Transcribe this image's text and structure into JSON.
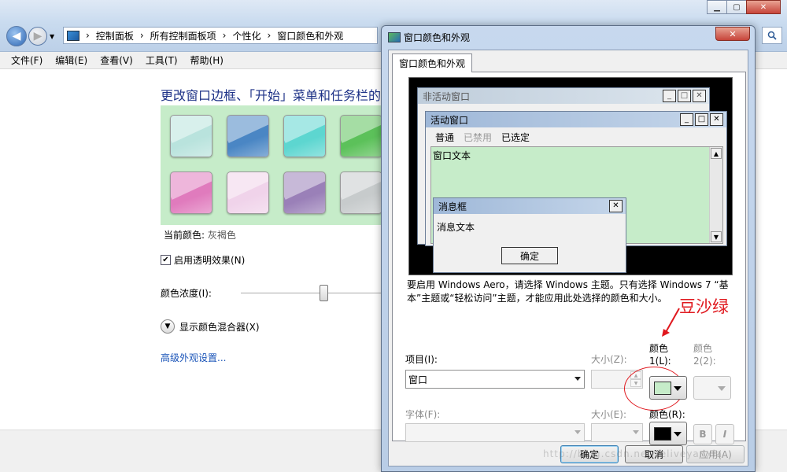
{
  "background_window": {
    "breadcrumbs": [
      "控制面板",
      "所有控制面板项",
      "个性化",
      "窗口颜色和外观"
    ],
    "menu": [
      "文件(F)",
      "编辑(E)",
      "查看(V)",
      "工具(T)",
      "帮助(H)"
    ],
    "heading": "更改窗口边框、「开始」菜单和任务栏的",
    "swatch_colors": [
      "#b9e3dd",
      "#4a86c4",
      "#5dd6d0",
      "#5cc15a",
      "#e07bbd",
      "#f0d3ea",
      "#9a80b8",
      "#c7cbcc"
    ],
    "current_color_label": "当前颜色:",
    "current_color_value": "灰褐色",
    "transparency_label": "启用透明效果(N)",
    "transparency_checked": true,
    "intensity_label": "颜色浓度(I):",
    "mixer_label": "显示颜色混合器(X)",
    "advanced_link": "高级外观设置..."
  },
  "dialog": {
    "title": "窗口颜色和外观",
    "tab": "窗口颜色和外观",
    "preview": {
      "inactive_title": "非活动窗口",
      "active_title": "活动窗口",
      "menu_normal": "普通",
      "menu_disabled": "已禁用",
      "menu_selected": "已选定",
      "window_text": "窗口文本",
      "msgbox_title": "消息框",
      "msgbox_text": "消息文本",
      "msgbox_ok": "确定",
      "window_bg_color": "#c6ecc9"
    },
    "note": "要启用 Windows Aero，请选择 Windows 主题。只有选择 Windows 7 “基本”主题或“轻松访问”主题，才能应用此处选择的颜色和大小。",
    "annotation": "豆沙绿",
    "item_label": "项目(I):",
    "item_value": "窗口",
    "size_label": "大小(Z):",
    "color1_label": "颜色 1(L):",
    "color2_label": "颜色 2(2):",
    "color1_value": "#c6ecc9",
    "font_label": "字体(F):",
    "font_size_label": "大小(E):",
    "font_color_label": "颜色(R):",
    "font_color_value": "#000000",
    "bold_label": "B",
    "italic_label": "I",
    "ok": "确定",
    "cancel": "取消",
    "apply": "应用(A)"
  },
  "watermark": "http://blog.csdn.net/reliveyanxia"
}
